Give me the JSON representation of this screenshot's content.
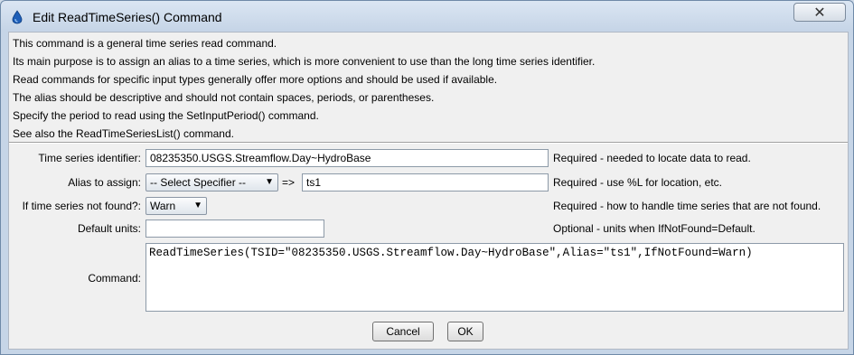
{
  "window": {
    "title": "Edit ReadTimeSeries() Command",
    "close_icon": "✕"
  },
  "description": [
    "This command is a general time series read command.",
    "Its main purpose is to assign an alias to a time series, which is more convenient to use than the long time series identifier.",
    "Read commands for specific input types generally offer more options and should be used if available.",
    "The alias should be descriptive and should not contain spaces, periods, or parentheses.",
    "Specify the period to read using the SetInputPeriod() command.",
    "See also the ReadTimeSeriesList() command."
  ],
  "form": {
    "tsid": {
      "label": "Time series identifier:",
      "value": "08235350.USGS.Streamflow.Day~HydroBase",
      "note": "Required - needed to locate data to read."
    },
    "alias": {
      "label": "Alias to assign:",
      "specifier": "-- Select Specifier --",
      "operator": "=>",
      "value": "ts1",
      "note": "Required - use %L for location, etc."
    },
    "if_not_found": {
      "label": "If time series not found?:",
      "value": "Warn",
      "note": "Required - how to handle time series that are not found."
    },
    "default_units": {
      "label": "Default units:",
      "value": "",
      "note": "Optional - units when IfNotFound=Default."
    },
    "command": {
      "label": "Command:",
      "value": "ReadTimeSeries(TSID=\"08235350.USGS.Streamflow.Day~HydroBase\",Alias=\"ts1\",IfNotFound=Warn)"
    }
  },
  "buttons": {
    "cancel": "Cancel",
    "ok": "OK"
  }
}
